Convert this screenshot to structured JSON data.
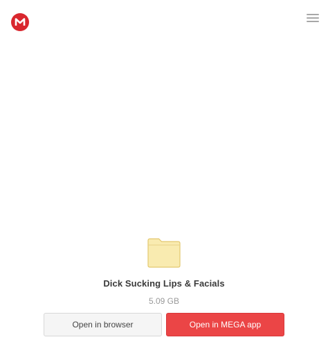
{
  "header": {
    "logo_icon": "mega-logo-icon",
    "menu_icon": "hamburger-menu-icon"
  },
  "file": {
    "icon": "folder-icon",
    "name": "Dick Sucking Lips & Facials",
    "size": "5.09 GB"
  },
  "actions": {
    "open_in_browser_label": "Open in browser",
    "open_in_app_label": "Open in MEGA app"
  },
  "colors": {
    "brand_red": "#d9272e",
    "primary_button": "#eb4546",
    "folder_fill": "#f9ebb0",
    "folder_stroke": "#e3c86f",
    "secondary_button_bg": "#f5f5f5"
  }
}
